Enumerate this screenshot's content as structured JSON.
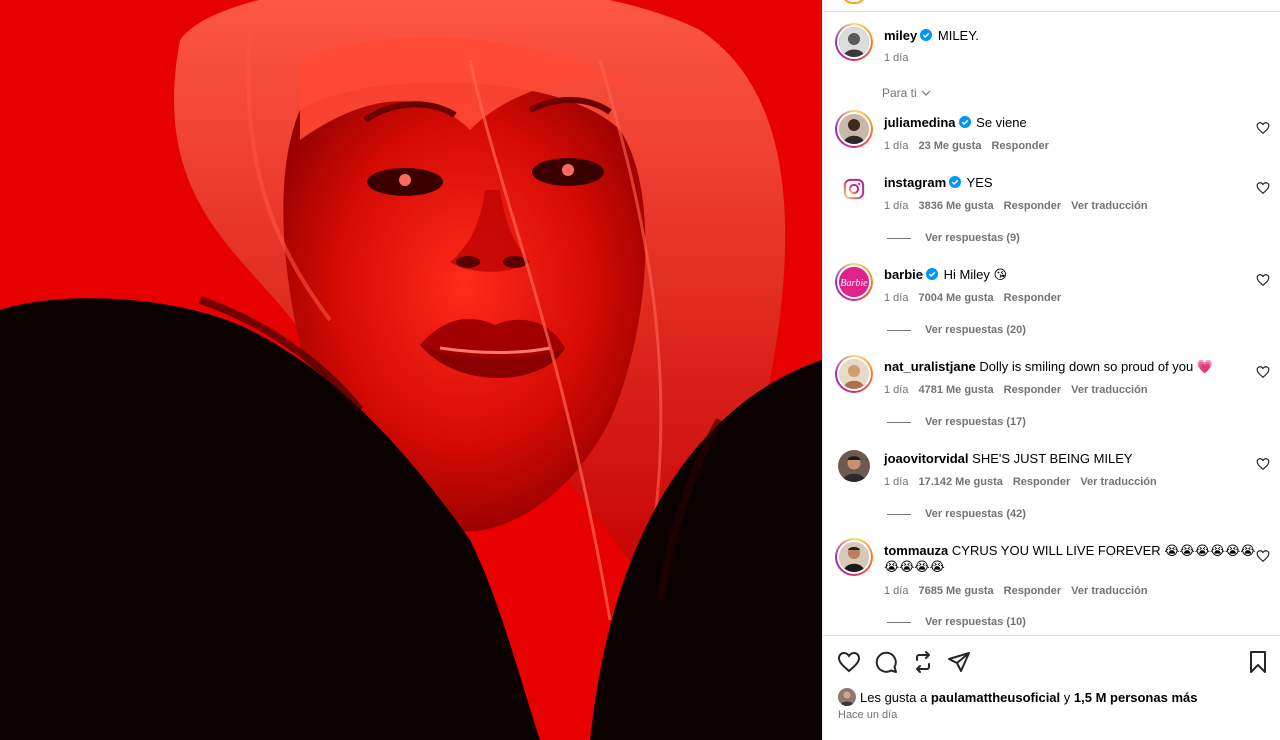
{
  "post": {
    "author": "miley",
    "caption": "MILEY.",
    "time": "1 día",
    "verified": true
  },
  "sort_label": "Para ti",
  "comments": [
    {
      "user": "juliamedina",
      "verified": true,
      "text": "Se viene",
      "time": "1 día",
      "likes": "23 Me gusta",
      "reply": "Responder",
      "translate": "",
      "replies": ""
    },
    {
      "user": "instagram",
      "verified": true,
      "text": "YES",
      "time": "1 día",
      "likes": "3836 Me gusta",
      "reply": "Responder",
      "translate": "Ver traducción",
      "replies": "Ver respuestas (9)"
    },
    {
      "user": "barbie",
      "verified": true,
      "text": "Hi Miley 😘",
      "time": "1 día",
      "likes": "7004 Me gusta",
      "reply": "Responder",
      "translate": "",
      "replies": "Ver respuestas (20)"
    },
    {
      "user": "nat_uralistjane",
      "verified": false,
      "text": "Dolly is smiling down so proud of you 💗",
      "time": "1 día",
      "likes": "4781 Me gusta",
      "reply": "Responder",
      "translate": "Ver traducción",
      "replies": "Ver respuestas (17)"
    },
    {
      "user": "joaovitorvidal",
      "verified": false,
      "text": "SHE'S JUST BEING MILEY",
      "time": "1 día",
      "likes": "17.142 Me gusta",
      "reply": "Responder",
      "translate": "Ver traducción",
      "replies": "Ver respuestas (42)"
    },
    {
      "user": "tommauza",
      "verified": false,
      "text": "CYRUS YOU WILL LIVE FOREVER 😭😭😭😭😭😭",
      "text2": "😭😭😭😭",
      "time": "1 día",
      "likes": "7685 Me gusta",
      "reply": "Responder",
      "translate": "Ver traducción",
      "replies": "Ver respuestas (10)"
    }
  ],
  "footer": {
    "likes_prefix": "Les gusta a",
    "likes_user": "paulamattheusoficial",
    "likes_middle": "y",
    "likes_count": "1,5 M personas más",
    "time": "Hace un día"
  },
  "colors": {
    "photo_background": "#e40000",
    "verified_badge": "#0095f6",
    "muted_text": "#737373",
    "divider": "#dbdbdb"
  },
  "icons": [
    "heart-icon",
    "comment-icon",
    "repost-icon",
    "share-icon",
    "bookmark-icon",
    "verified-badge-icon",
    "chevron-down-icon",
    "instagram-logo-icon"
  ]
}
